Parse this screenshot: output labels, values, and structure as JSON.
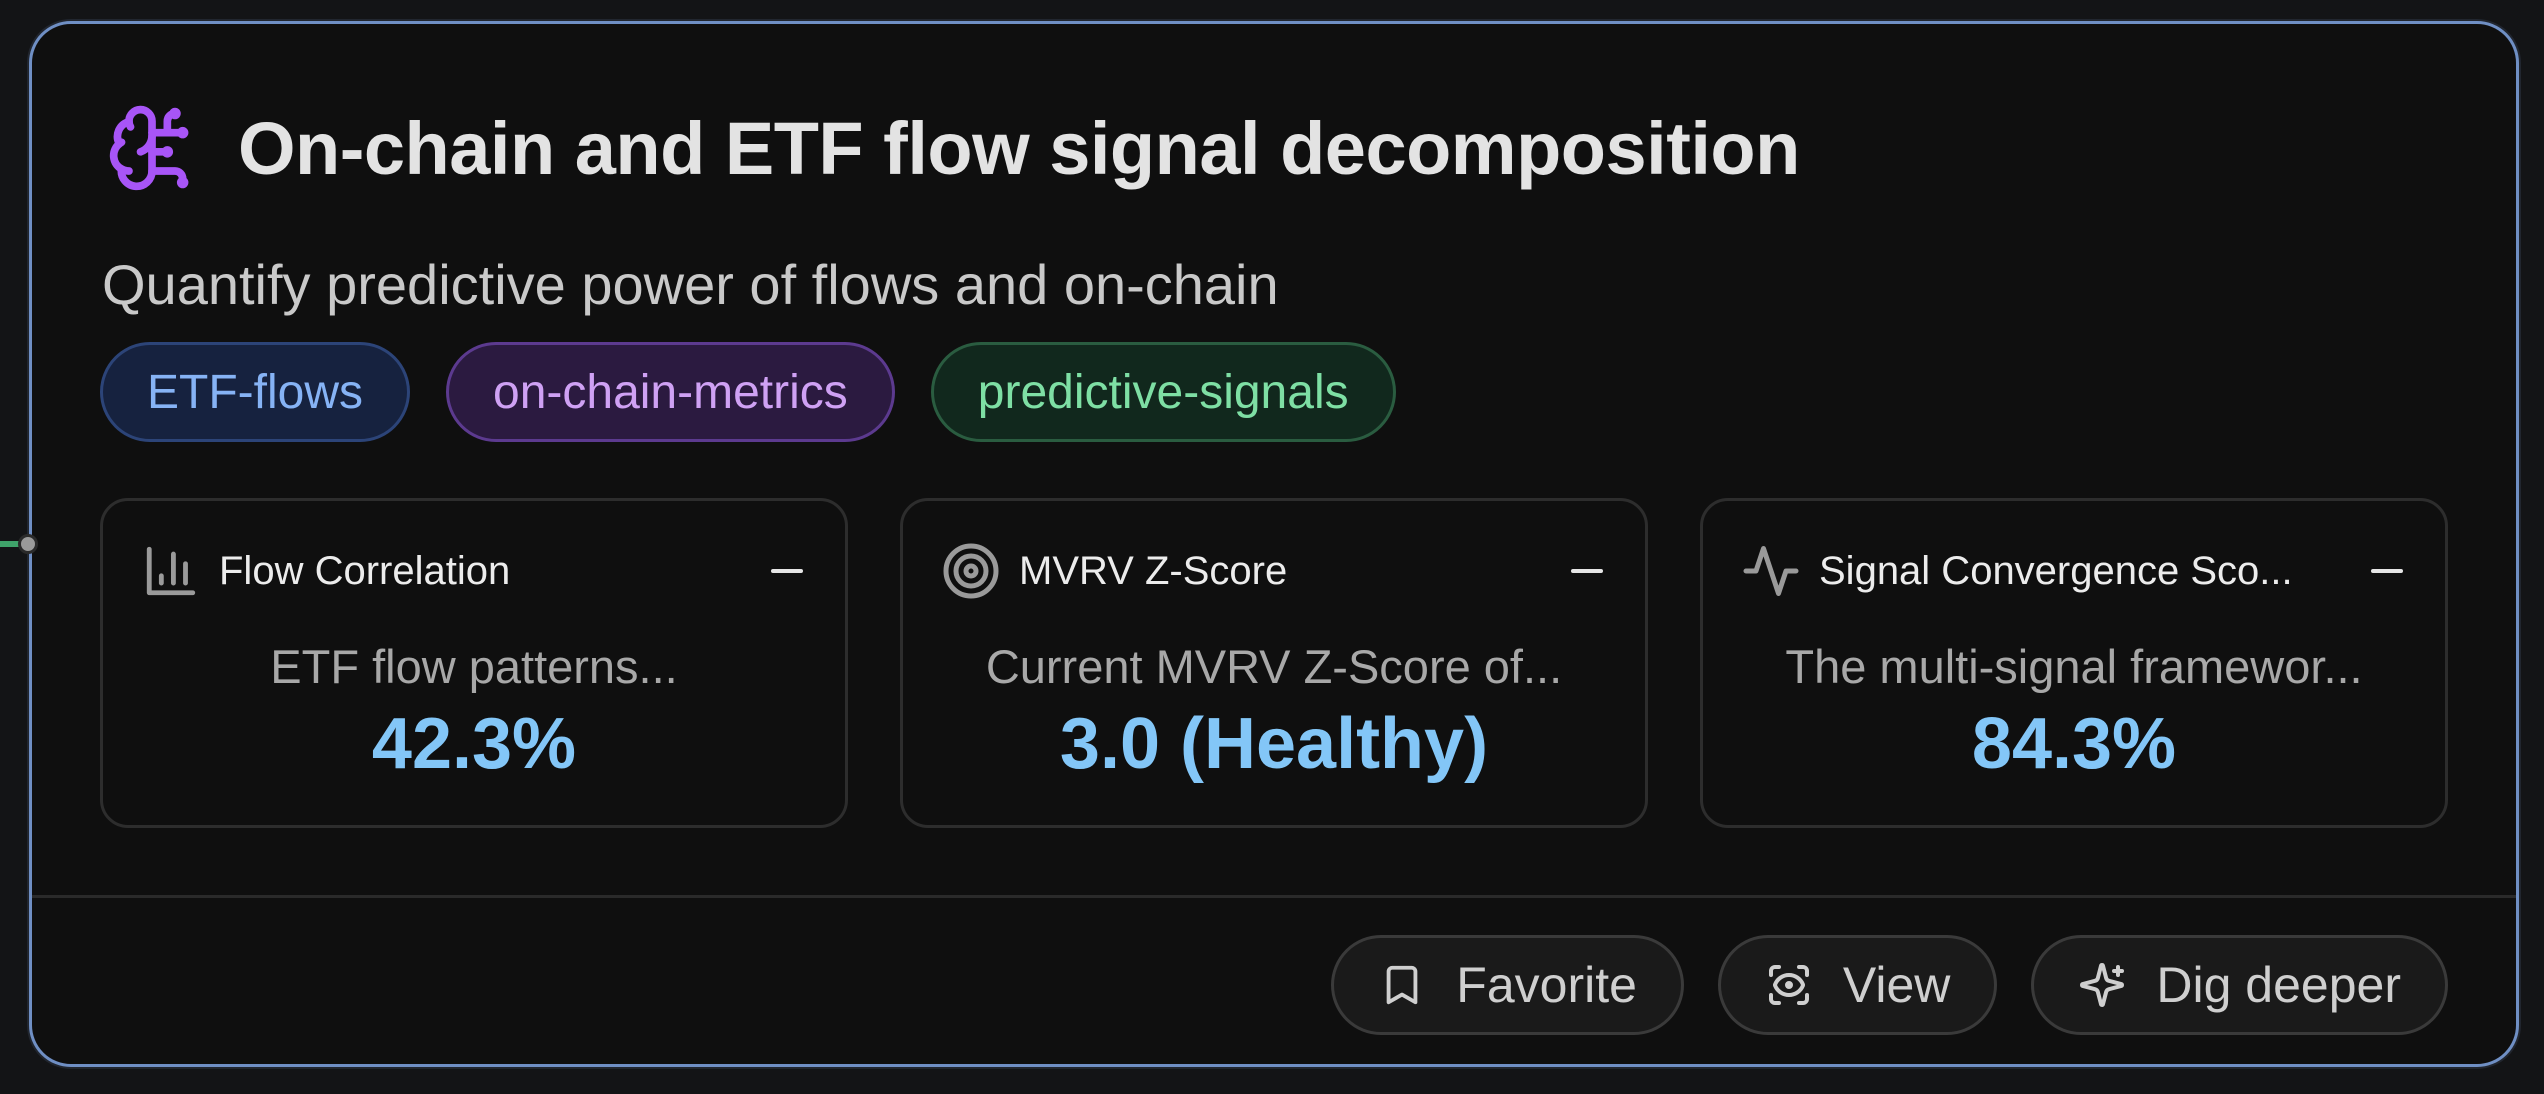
{
  "header": {
    "title": "On-chain and ETF flow signal decomposition",
    "subtitle": "Quantify predictive power of flows and on-chain",
    "icon": "brain-circuit-icon",
    "icon_color": "#a855f7"
  },
  "tags": [
    {
      "label": "ETF-flows",
      "color": "#86b3f5"
    },
    {
      "label": "on-chain-metrics",
      "color": "#cfa1f4"
    },
    {
      "label": "predictive-signals",
      "color": "#7edfa4"
    }
  ],
  "metrics": [
    {
      "icon": "bar-chart-icon",
      "title": "Flow Correlation",
      "description": "ETF flow patterns...",
      "value": "42.3%"
    },
    {
      "icon": "target-icon",
      "title": "MVRV Z-Score",
      "description": "Current MVRV Z-Score of...",
      "value": "3.0 (Healthy)"
    },
    {
      "icon": "activity-icon",
      "title": "Signal Convergence Sco...",
      "description": "The multi-signal framewor...",
      "value": "84.3%"
    }
  ],
  "actions": [
    {
      "label": "Favorite",
      "icon": "bookmark-icon"
    },
    {
      "label": "View",
      "icon": "eye-scan-icon"
    },
    {
      "label": "Dig deeper",
      "icon": "sparkles-icon"
    }
  ],
  "colors": {
    "accent": "#83c6f7",
    "border": "#6f8fc4",
    "background": "#0f0f0f"
  }
}
